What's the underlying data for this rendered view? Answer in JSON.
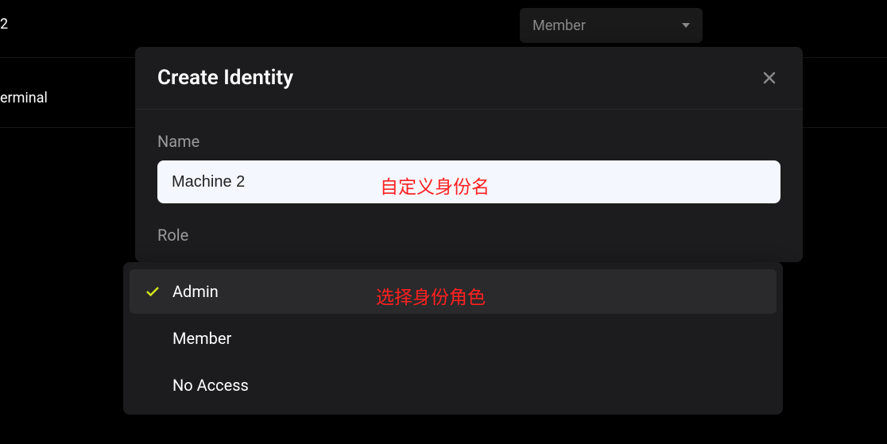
{
  "background": {
    "partial_text_top": "2",
    "partial_text_side": "erminal",
    "select_label": "Member"
  },
  "modal": {
    "title": "Create Identity",
    "name_label": "Name",
    "name_value": "Machine 2",
    "role_label": "Role"
  },
  "dropdown": {
    "options": [
      {
        "label": "Admin",
        "selected": true
      },
      {
        "label": "Member",
        "selected": false
      },
      {
        "label": "No Access",
        "selected": false
      }
    ]
  },
  "annotations": {
    "name_hint": "自定义身份名",
    "role_hint": "选择身份角色"
  }
}
